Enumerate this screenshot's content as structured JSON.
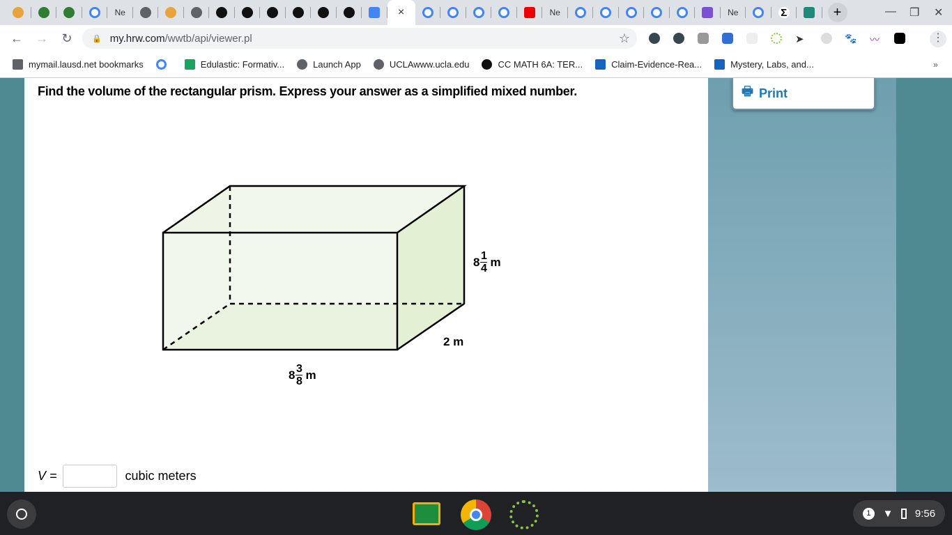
{
  "browser": {
    "tabs": [
      {
        "icon": "hand-icon",
        "color": "#e8a33a"
      },
      {
        "icon": "green-circle-icon",
        "color": "#2e7d32"
      },
      {
        "icon": "green-circle-icon",
        "color": "#2e7d32"
      },
      {
        "icon": "google-icon",
        "color": "#4285f4"
      },
      {
        "label": "Ne"
      },
      {
        "icon": "globe-icon",
        "color": "#5f6368"
      },
      {
        "icon": "hand-icon",
        "color": "#e8a33a"
      },
      {
        "icon": "globe-icon",
        "color": "#5f6368"
      },
      {
        "icon": "schoology-icon",
        "color": "#111"
      },
      {
        "icon": "schoology-icon",
        "color": "#111"
      },
      {
        "icon": "schoology-icon",
        "color": "#111"
      },
      {
        "icon": "schoology-icon",
        "color": "#111"
      },
      {
        "icon": "schoology-icon",
        "color": "#111"
      },
      {
        "icon": "schoology-icon",
        "color": "#111"
      },
      {
        "icon": "docs-icon",
        "color": "#4285f4"
      },
      {
        "active": true,
        "label": "×"
      },
      {
        "icon": "google-icon",
        "color": "#4285f4"
      },
      {
        "icon": "google-icon",
        "color": "#4285f4"
      },
      {
        "icon": "google-icon",
        "color": "#4285f4"
      },
      {
        "icon": "google-icon",
        "color": "#4285f4"
      },
      {
        "icon": "youtube-icon",
        "color": "#e00"
      },
      {
        "label": "Ne"
      },
      {
        "icon": "google-icon",
        "color": "#4285f4"
      },
      {
        "icon": "google-icon",
        "color": "#4285f4"
      },
      {
        "icon": "google-icon",
        "color": "#4285f4"
      },
      {
        "icon": "google-icon",
        "color": "#4285f4"
      },
      {
        "icon": "google-icon",
        "color": "#4285f4"
      },
      {
        "icon": "s-purple-icon",
        "color": "#7b4fd6"
      },
      {
        "label": "Ne"
      },
      {
        "icon": "google-icon",
        "color": "#4285f4"
      },
      {
        "icon": "sigma-icon",
        "color": "#fff"
      },
      {
        "icon": "fraction-icon",
        "color": "#1f8a7a"
      }
    ],
    "url_host": "my.hrw.com",
    "url_path": "/wwtb/api/viewer.pl",
    "bookmarks": [
      {
        "label": "mymail.lausd.net bookmarks",
        "icon": "folder-icon",
        "color": "#5f6368"
      },
      {
        "label": "",
        "icon": "google-icon",
        "color": "#4285f4"
      },
      {
        "label": "Edulastic: Formativ...",
        "icon": "edulastic-icon",
        "color": "#1aa260"
      },
      {
        "label": "Launch App",
        "icon": "globe-icon",
        "color": "#5f6368"
      },
      {
        "label": "UCLAwww.ucla.edu",
        "icon": "globe-icon",
        "color": "#5f6368"
      },
      {
        "label": "CC MATH 6A: TER...",
        "icon": "schoology-icon",
        "color": "#111"
      },
      {
        "label": "Claim-Evidence-Rea...",
        "icon": "m-icon",
        "color": "#1565c0"
      },
      {
        "label": "Mystery, Labs, and...",
        "icon": "m-icon",
        "color": "#1565c0"
      }
    ],
    "more": "»"
  },
  "page": {
    "question": "Find the volume of the rectangular prism. Express your answer as a simplified mixed number.",
    "print": "Print",
    "height": {
      "whole": "8",
      "num": "1",
      "den": "4",
      "unit": "m"
    },
    "depth": "2 m",
    "length": {
      "whole": "8",
      "num": "3",
      "den": "8",
      "unit": "m"
    },
    "answer_var": "V =",
    "answer_unit": "cubic meters",
    "answer_value": ""
  },
  "shelf": {
    "notifications": "1",
    "time": "9:56"
  }
}
